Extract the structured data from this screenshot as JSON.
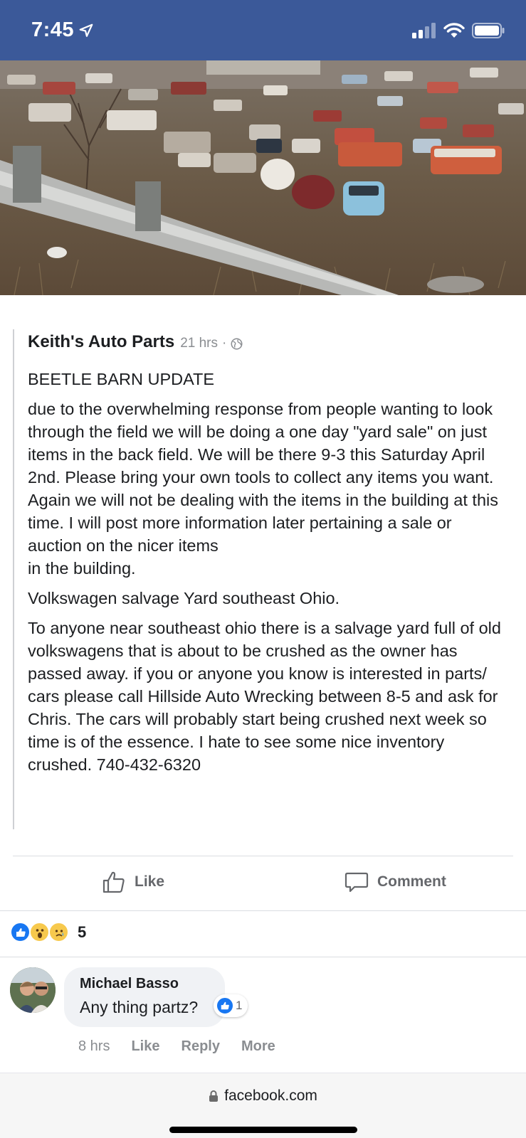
{
  "status_bar": {
    "time": "7:45",
    "icons": [
      "location-arrow-icon",
      "signal-icon",
      "wifi-icon",
      "battery-icon"
    ]
  },
  "photo": {
    "description_icon": "junkyard-photo"
  },
  "post": {
    "author": "Keith's Auto Parts",
    "time": "21 hrs",
    "separator": "·",
    "privacy_icon": "globe-icon",
    "paragraphs": [
      "BEETLE BARN UPDATE",
      "due to the overwhelming response from people wanting to look through the field we will be doing a one day \"yard sale\" on just items in the back field. We will be there 9-3 this Saturday April 2nd. Please bring your own tools to collect any items you want. Again we will not be dealing with the items in the building at this time. I will post more information later pertaining a sale or auction on the nicer items",
      "in the building.",
      "Volkswagen salvage Yard southeast Ohio.",
      "To anyone near southeast ohio there is a salvage yard full of old volkswagens that is about to be crushed as the owner has passed away. if you or anyone you know is interested in parts/ cars please call Hillside Auto Wrecking between 8-5 and ask for Chris. The cars will probably start being crushed next week so time is of the essence. I hate to see some nice inventory crushed. 740-432-6320"
    ]
  },
  "actions": {
    "like_label": "Like",
    "comment_label": "Comment"
  },
  "reactions": {
    "types": [
      "like",
      "wow",
      "sad"
    ],
    "count": "5"
  },
  "comment": {
    "author": "Michael Basso",
    "text": "Any thing partz?",
    "reaction_count": "1",
    "time": "8 hrs",
    "like_label": "Like",
    "reply_label": "Reply",
    "more_label": "More"
  },
  "browser": {
    "url": "facebook.com"
  },
  "colors": {
    "brand_blue": "#3b5999",
    "like_blue": "#1877f2",
    "muted_text": "#65676b"
  }
}
